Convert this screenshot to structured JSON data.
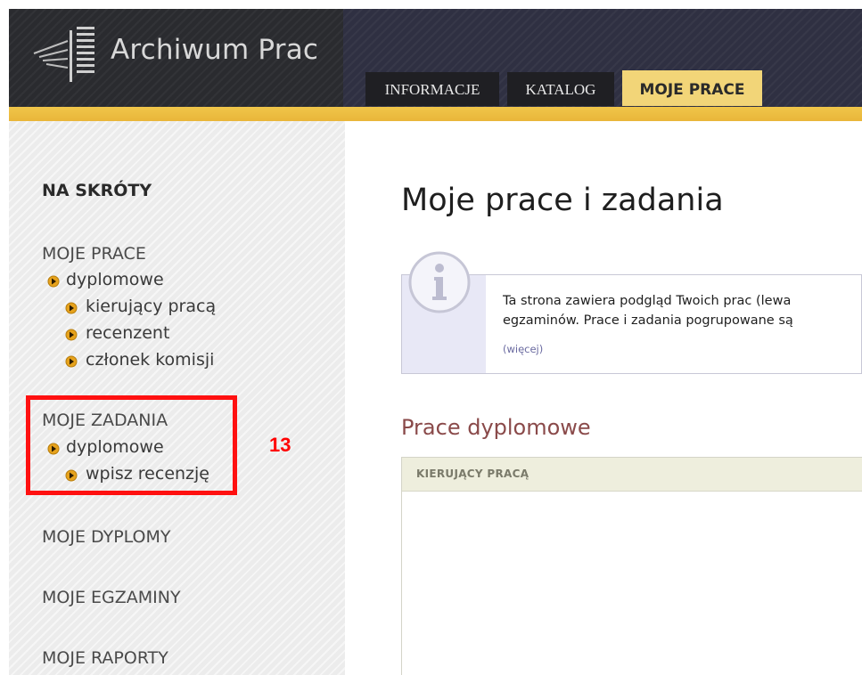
{
  "app": {
    "title": "Archiwum Prac"
  },
  "nav": {
    "tabs": [
      {
        "label": "INFORMACJE",
        "active": false
      },
      {
        "label": "KATALOG",
        "active": false
      },
      {
        "label": "MOJE PRACE",
        "active": true
      }
    ]
  },
  "sidebar": {
    "heading": "NA SKRÓTY",
    "sections": [
      {
        "title": "MOJE PRACE",
        "items": [
          {
            "label": "dyplomowe",
            "level": 1
          },
          {
            "label": "kierujący pracą",
            "level": 2
          },
          {
            "label": "recenzent",
            "level": 2
          },
          {
            "label": "członek komisji",
            "level": 2
          }
        ]
      },
      {
        "title": "MOJE ZADANIA",
        "items": [
          {
            "label": "dyplomowe",
            "level": 1
          },
          {
            "label": "wpisz recenzję",
            "level": 2
          }
        ]
      },
      {
        "title": "MOJE DYPLOMY",
        "items": []
      },
      {
        "title": "MOJE EGZAMINY",
        "items": []
      },
      {
        "title": "MOJE RAPORTY",
        "items": []
      }
    ]
  },
  "annotation": {
    "number": "13",
    "color": "#ff0000"
  },
  "main": {
    "title": "Moje prace i zadania",
    "info": {
      "line1": "Ta strona zawiera podgląd Twoich prac (lewa",
      "line2": "egzaminów. Prace i zadania pogrupowane są",
      "more": "(więcej)"
    },
    "section_title": "Prace dyplomowe",
    "table": {
      "columns": [
        "KIERUJĄCY PRACĄ"
      ]
    }
  },
  "colors": {
    "accent_gold": "#f0c64a",
    "active_tab": "#f2d578",
    "header_dark": "#2c2d35",
    "section_title": "#8a4a4a"
  }
}
